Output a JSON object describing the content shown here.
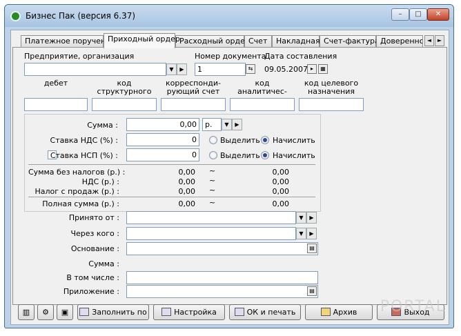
{
  "window": {
    "title": "Бизнес Пак (версия 6.37)",
    "minimize": "–",
    "maximize": "□",
    "close": "✕"
  },
  "tabs": [
    "Платежное поручение",
    "Приходный ордер",
    "Расходный ордер",
    "Счет",
    "Накладная",
    "Счет-фактура",
    "Доверенность"
  ],
  "active_tab": 1,
  "tab_scroll": {
    "left": "◄",
    "right": "►"
  },
  "form": {
    "org_label": "Предприятие, организация",
    "org_value": "",
    "docnum_label": "Номер документа",
    "docnum_value": "1",
    "date_label": "Дата составления",
    "date_value": "09.05.2007",
    "columns": [
      "дебет",
      "код структурного подразделения",
      "корреспонди-рующий счет",
      "код аналитичес-кого учета",
      "код целевого назначения"
    ],
    "sum_label": "Сумма :",
    "sum_value": "0,00",
    "currency": "р.",
    "vat_label": "Ставка НДС (%) :",
    "vat_value": "0",
    "nsp_label": "Ставка НСП (%) :",
    "nsp_value": "0",
    "opt_allocate": "Выделить",
    "opt_charge": "Начислить",
    "vat_mode": "charge",
    "nsp_mode": "charge",
    "nsp_checked": false,
    "totals": [
      {
        "label": "Сумма без налогов (р.) :",
        "a": "0,00",
        "t": "~",
        "b": "0,00"
      },
      {
        "label": "НДС (р.) :",
        "a": "0,00",
        "t": "~",
        "b": "0,00"
      },
      {
        "label": "Налог с продаж (р.) :",
        "a": "0,00",
        "t": "~",
        "b": "0,00"
      },
      {
        "label": "Полная сумма (р.) :",
        "a": "0,00",
        "t": "~",
        "b": "0,00"
      }
    ],
    "accepted_from_label": "Принято от :",
    "via_label": "Через кого :",
    "basis_label": "Основание :",
    "sum2_label": "Сумма :",
    "including_label": "В том числе :",
    "attachment_label": "Приложение :"
  },
  "buttons": {
    "fill": "Заполнить по",
    "settings": "Настройка",
    "ok_print": "ОК и печать",
    "archive": "Архив",
    "exit": "Выход"
  },
  "watermark": "PORTAL"
}
